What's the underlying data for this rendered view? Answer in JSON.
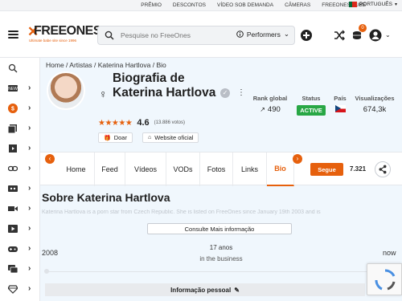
{
  "topbar": {
    "links": [
      "PRÊMIO",
      "DESCONTOS",
      "VÍDEO SOB DEMANDA",
      "CÂMERAS",
      "FREEONES TUBE"
    ],
    "language": "PORTUGUÊS"
  },
  "header": {
    "logo_text": "FREEONES",
    "logo_tagline": "Ultimate babe site since 1996",
    "search_placeholder": "Pesquise no FreeOnes",
    "search_scope": "Performers",
    "notification_count": "0"
  },
  "sidebar": {
    "items": [
      {
        "icon": "search-icon",
        "active": false
      },
      {
        "icon": "new-icon",
        "active": false
      },
      {
        "icon": "coin-icon",
        "active": true
      },
      {
        "icon": "photos-icon",
        "active": false
      },
      {
        "icon": "clips-icon",
        "active": false
      },
      {
        "icon": "link-icon",
        "active": false
      },
      {
        "icon": "discount-icon",
        "active": false
      },
      {
        "icon": "camera-icon",
        "active": false
      },
      {
        "icon": "video-icon",
        "active": false
      },
      {
        "icon": "gamepad-icon",
        "active": false
      },
      {
        "icon": "chat-icon",
        "active": false
      },
      {
        "icon": "diamond-icon",
        "active": false
      }
    ]
  },
  "breadcrumb": "Home / Artistas / Katerina Hartlova / Bio",
  "profile": {
    "title": "Biografia de Katerina Hartlova",
    "rating": "4.6",
    "votes": "(13.886 votos)",
    "donate_label": "Doar",
    "website_label": "Website oficial"
  },
  "stats": {
    "rank_label": "Rank global",
    "rank_value": "490",
    "status_label": "Status",
    "status_value": "ACTIVE",
    "country_label": "País",
    "views_label": "Visualizações",
    "views_value": "674,3k"
  },
  "tabs": {
    "items": [
      "Home",
      "Feed",
      "Vídeos",
      "VODs",
      "Fotos",
      "Links",
      "Bio"
    ],
    "active": "Bio",
    "follow_label": "Segue",
    "follow_count": "7.321"
  },
  "about": {
    "title": "Sobre Katerina Hartlova",
    "text": "Katerina Hartlova is a porn star from Czech Republic. She is listed on FreeOnes since January 19th 2003 and is",
    "more_label": "Consulte Mais informação"
  },
  "timeline": {
    "start": "2008",
    "years": "17 anos",
    "subtitle": "in the business",
    "end": "now"
  },
  "personal_info_label": "Informação pessoal",
  "colors": {
    "accent": "#e6600d",
    "status_active": "#28a745",
    "page_bg": "#f0f7fd"
  }
}
